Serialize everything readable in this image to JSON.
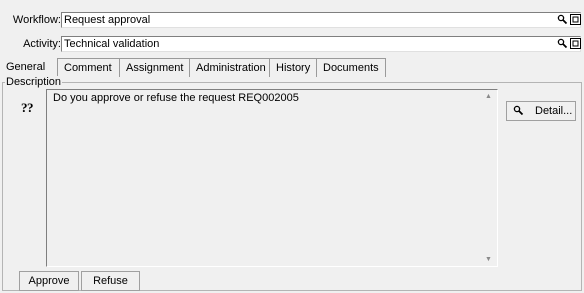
{
  "workflow": {
    "label": "Workflow:",
    "value": "Request approval"
  },
  "activity": {
    "label": "Activity:",
    "value": "Technical validation"
  },
  "tabs": [
    {
      "label": "General",
      "active": true
    },
    {
      "label": "Comment"
    },
    {
      "label": "Assignment"
    },
    {
      "label": "Administration"
    },
    {
      "label": "History"
    },
    {
      "label": "Documents"
    }
  ],
  "description": {
    "group_label": "Description",
    "text": "Do you approve or refuse the request REQ002005",
    "icon": "question-icon"
  },
  "detail_button": {
    "label": "Detail...",
    "icon": "magnifier-icon"
  },
  "actions": {
    "approve_label": "Approve",
    "refuse_label": "Refuse"
  },
  "colors": {
    "background": "#f0f0f0",
    "field": "#ffffff",
    "border": "#7f7f7f"
  }
}
